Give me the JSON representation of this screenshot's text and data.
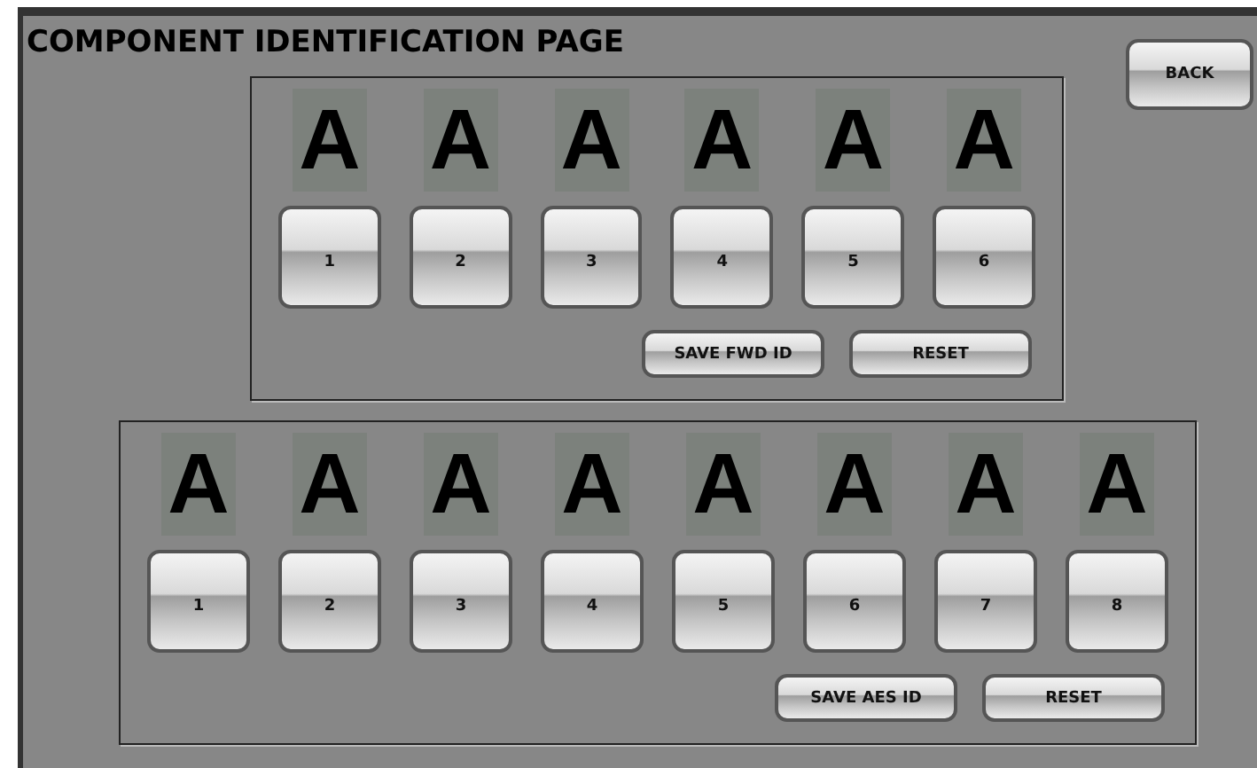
{
  "title": "COMPONENT IDENTIFICATION PAGE",
  "back_button": "BACK",
  "panels": [
    {
      "letters": [
        "A",
        "A",
        "A",
        "A",
        "A",
        "A"
      ],
      "buttons": [
        "1",
        "2",
        "3",
        "4",
        "5",
        "6"
      ],
      "actions": [
        "SAVE FWD ID",
        "RESET"
      ]
    },
    {
      "letters": [
        "A",
        "A",
        "A",
        "A",
        "A",
        "A",
        "A",
        "A"
      ],
      "buttons": [
        "1",
        "2",
        "3",
        "4",
        "5",
        "6",
        "7",
        "8"
      ],
      "actions": [
        "SAVE AES ID",
        "RESET"
      ]
    }
  ]
}
